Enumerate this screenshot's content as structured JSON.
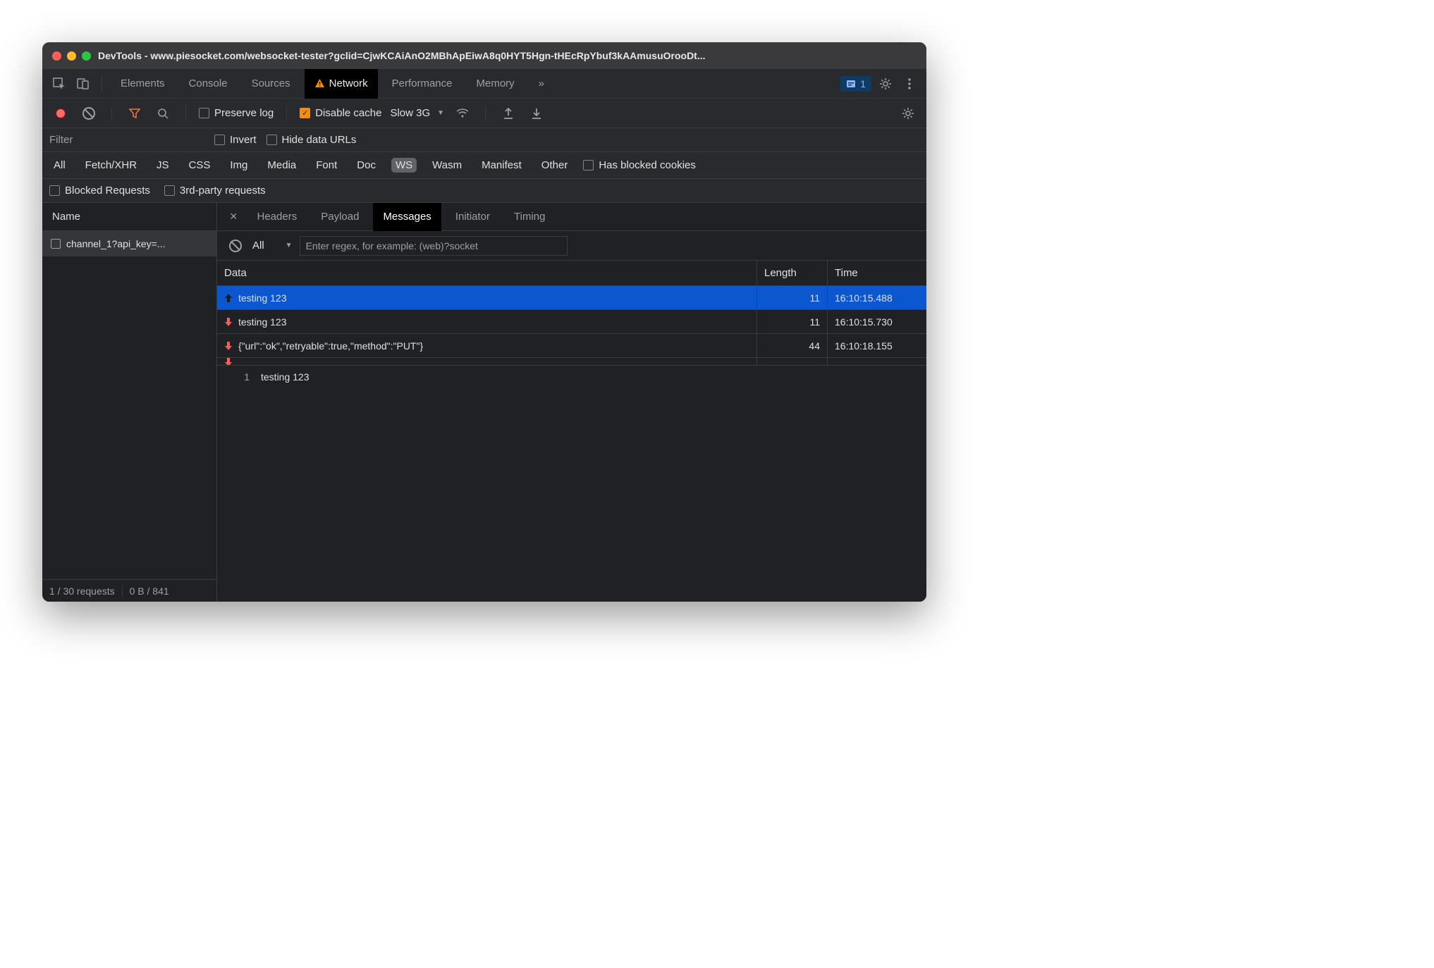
{
  "window": {
    "title": "DevTools - www.piesocket.com/websocket-tester?gclid=CjwKCAiAnO2MBhApEiwA8q0HYT5Hgn-tHEcRpYbuf3kAAmusuOrooDt..."
  },
  "tabs": {
    "items": [
      "Elements",
      "Console",
      "Sources",
      "Network",
      "Performance",
      "Memory"
    ],
    "active": "Network",
    "overflow": "»",
    "issues_count": "1"
  },
  "toolbar": {
    "preserve_log": "Preserve log",
    "disable_cache": "Disable cache",
    "throttle": "Slow 3G"
  },
  "filter": {
    "placeholder": "Filter",
    "invert": "Invert",
    "hide_data_urls": "Hide data URLs"
  },
  "types": [
    "All",
    "Fetch/XHR",
    "JS",
    "CSS",
    "Img",
    "Media",
    "Font",
    "Doc",
    "WS",
    "Wasm",
    "Manifest",
    "Other"
  ],
  "types_active": "WS",
  "extras": {
    "has_blocked": "Has blocked cookies",
    "blocked_requests": "Blocked Requests",
    "third_party": "3rd-party requests"
  },
  "name_col": {
    "header": "Name",
    "items": [
      "channel_1?api_key=..."
    ]
  },
  "status": {
    "requests": "1 / 30 requests",
    "transfer": "0 B / 841"
  },
  "detail_tabs": {
    "items": [
      "Headers",
      "Payload",
      "Messages",
      "Initiator",
      "Timing"
    ],
    "active": "Messages"
  },
  "msg_filter": {
    "all": "All",
    "regex_placeholder": "Enter regex, for example: (web)?socket"
  },
  "msg_table": {
    "headers": {
      "data": "Data",
      "length": "Length",
      "time": "Time"
    },
    "rows": [
      {
        "dir": "up",
        "data": "testing 123",
        "length": "11",
        "time": "16:10:15.488",
        "selected": true
      },
      {
        "dir": "down",
        "data": "testing 123",
        "length": "11",
        "time": "16:10:15.730",
        "selected": false
      },
      {
        "dir": "down",
        "data": "{\"url\":\"ok\",\"retryable\":true,\"method\":\"PUT\"}",
        "length": "44",
        "time": "16:10:18.155",
        "selected": false
      }
    ],
    "partial_row": {
      "dir": "down",
      "data": "",
      "length": "",
      "time": ""
    }
  },
  "content": {
    "line_no": "1",
    "text": "testing 123"
  }
}
